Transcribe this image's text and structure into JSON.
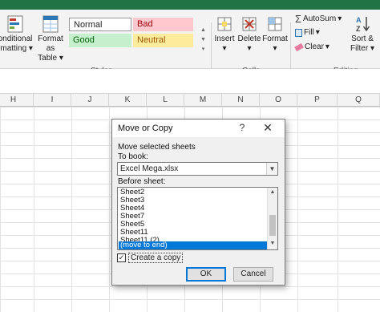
{
  "ribbon": {
    "conditional_formatting": "onditional\nrmatting",
    "format_as_table": "Format as\nTable",
    "styles": {
      "normal": "Normal",
      "bad": "Bad",
      "good": "Good",
      "neutral": "Neutral",
      "group_label": "Styles"
    },
    "cells": {
      "insert": "Insert",
      "delete": "Delete",
      "format": "Format",
      "group_label": "Cells"
    },
    "editing": {
      "autosum": "AutoSum",
      "fill": "Fill",
      "clear": "Clear",
      "sort_filter": "Sort &\nFilter",
      "group_label": "Editing"
    }
  },
  "columns": [
    "H",
    "I",
    "J",
    "K",
    "L",
    "M",
    "N",
    "O",
    "P",
    "Q"
  ],
  "dialog": {
    "title": "Move or Copy",
    "help": "?",
    "close": "✕",
    "move_selected_label": "Move selected sheets",
    "to_book_label": "To book:",
    "to_book_value": "Excel Mega.xlsx",
    "before_sheet_label": "Before sheet:",
    "sheets": [
      "Sheet2",
      "Sheet3",
      "Sheet4",
      "Sheet7",
      "Sheet5",
      "Sheet11",
      "Sheet11 (2)",
      "(move to end)"
    ],
    "selected_sheet": "(move to end)",
    "create_copy_label": "Create a copy",
    "create_copy_checked": true,
    "ok_label": "OK",
    "cancel_label": "Cancel"
  }
}
